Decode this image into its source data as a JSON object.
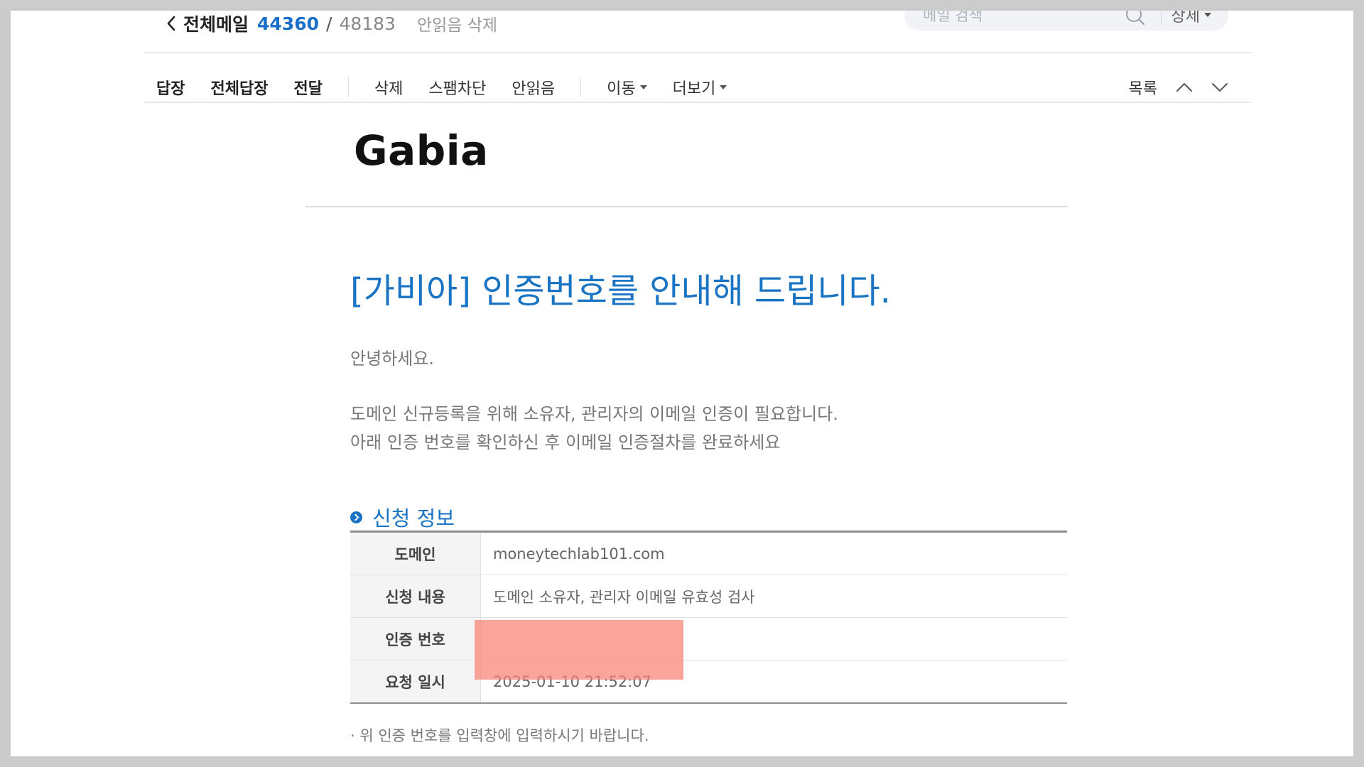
{
  "header": {
    "folder_name": "전체메일",
    "unread_count": "44360",
    "separator": "/",
    "total_count": "48183",
    "delete_unread_label": "안읽음 삭제",
    "search_placeholder": "메일 검색",
    "detail_label": "상세"
  },
  "toolbar": {
    "reply": "답장",
    "reply_all": "전체답장",
    "forward": "전달",
    "delete": "삭제",
    "spam_block": "스팸차단",
    "mark_unread": "안읽음",
    "move": "이동",
    "more": "더보기",
    "list": "목록"
  },
  "mail": {
    "brand": "Gabia",
    "title": "[가비아] 인증번호를 안내해 드립니다.",
    "greeting": "안녕하세요.",
    "para_line1": "도메인 신규등록을 위해 소유자, 관리자의 이메일 인증이 필요합니다.",
    "para_line2": "아래 인증 번호를 확인하신 후 이메일 인증절차를 완료하세요",
    "section_title": "신청 정보",
    "rows": [
      {
        "label": "도메인",
        "value": "moneytechlab101.com"
      },
      {
        "label": "신청 내용",
        "value": "도메인 소유자, 관리자 이메일 유효성 검사"
      },
      {
        "label": "인증 번호",
        "value": ""
      },
      {
        "label": "요청 일시",
        "value": "2025-01-10 21:52:07"
      }
    ],
    "note": "· 위 인증 번호를 입력창에 입력하시기 바랍니다."
  },
  "colors": {
    "accent": "#1a74c4",
    "unread_count": "#1a6fc9",
    "redaction": "#fa8273"
  }
}
